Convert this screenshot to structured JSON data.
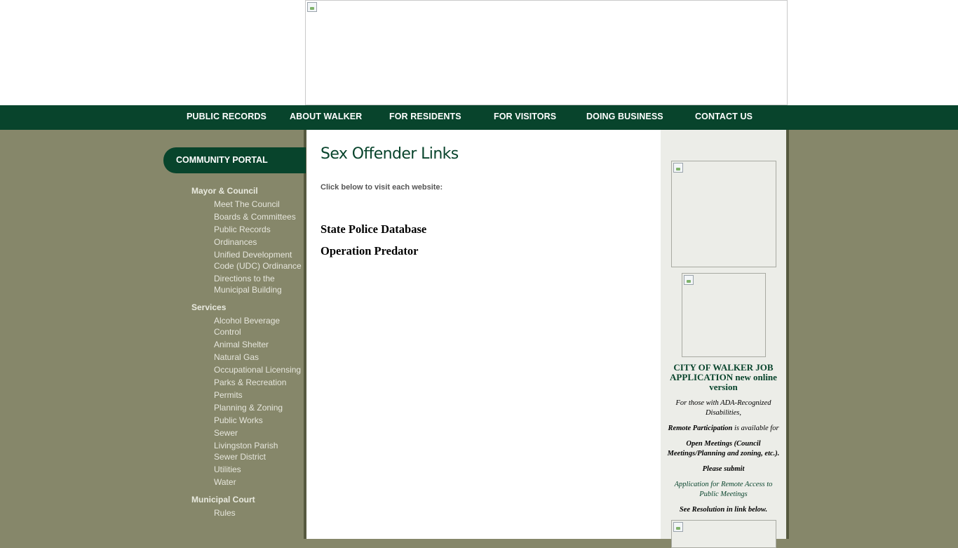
{
  "nav": {
    "items": [
      {
        "label": "PUBLIC RECORDS"
      },
      {
        "label": "ABOUT WALKER"
      },
      {
        "label": "FOR RESIDENTS"
      },
      {
        "label": "FOR VISITORS"
      },
      {
        "label": "DOING BUSINESS"
      },
      {
        "label": "CONTACT US"
      }
    ]
  },
  "sidebar": {
    "portal_title": "COMMUNITY PORTAL",
    "sections": [
      {
        "heading": "Mayor & Council",
        "links": [
          "Meet The Council",
          "Boards & Committees",
          "Public Records",
          "Ordinances",
          "Unified Development Code (UDC) Ordinance",
          "Directions to the Municipal Building"
        ]
      },
      {
        "heading": "Services",
        "links": [
          "Alcohol Beverage Control",
          "Animal Shelter",
          "Natural Gas",
          "Occupational Licensing",
          "Parks & Recreation",
          "Permits",
          "Planning & Zoning",
          "Public Works",
          "Sewer",
          "Livingston Parish Sewer District",
          "Utilities",
          "Water"
        ]
      },
      {
        "heading": "Municipal Court",
        "links": [
          "Rules"
        ]
      }
    ]
  },
  "main": {
    "title": "Sex Offender Links",
    "intro": "Click below to visit each website:",
    "links": [
      "State Police Database",
      "Operation Predator"
    ]
  },
  "right": {
    "job_app_title": "CITY OF WALKER JOB APPLICATION",
    "job_app_suffix": "new online version",
    "ada_line": "For those with ADA-Recognized Disabilities,",
    "remote_bold": "Remote Participation",
    "remote_rest": "is available for",
    "meetings_line": "Open Meetings (Council Meetings/Planning and zoning, etc.).",
    "please_submit": "Please submit",
    "app_link": "Application for Remote Access to Public Meetings",
    "resolution": "See Resolution in link below."
  },
  "colors": {
    "brand_green": "#08442c",
    "olive_bg": "#86876a",
    "right_panel": "#ecede8"
  }
}
